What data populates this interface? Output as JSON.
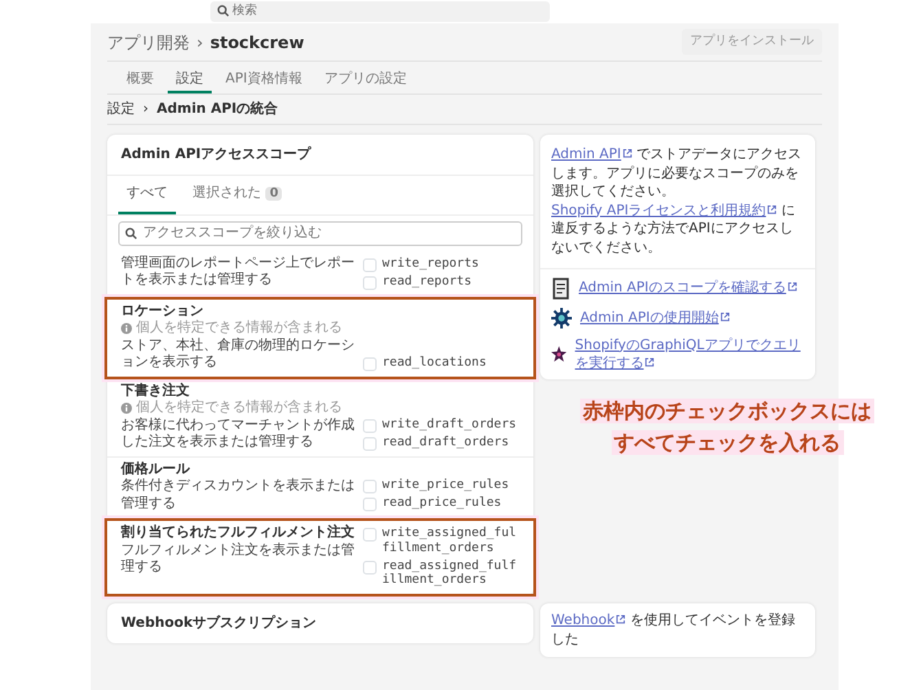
{
  "search_bar": {
    "placeholder": "検索"
  },
  "header": {
    "parent": "アプリ開発",
    "separator": "›",
    "app_name": "stockcrew",
    "install_button": "アプリをインストール"
  },
  "tabs": [
    {
      "label": "概要",
      "selected": false
    },
    {
      "label": "設定",
      "selected": true
    },
    {
      "label": "API資格情報",
      "selected": false
    },
    {
      "label": "アプリの設定",
      "selected": false
    }
  ],
  "breadcrumb": {
    "parent": "設定",
    "separator": "›",
    "current": "Admin APIの統合"
  },
  "scopes_card": {
    "title": "Admin APIアクセススコープ",
    "filter_tabs": [
      {
        "label": "すべて",
        "selected": true
      },
      {
        "label": "選択された",
        "selected": false,
        "count": "0"
      }
    ],
    "search": {
      "placeholder": "アクセススコープを絞り込む"
    },
    "groups": [
      {
        "description": "管理画面のレポートページ上でレポートを表示または管理する",
        "highlighted": false,
        "scopes": [
          {
            "name": "write_reports",
            "checked": false
          },
          {
            "name": "read_reports",
            "checked": false
          }
        ]
      },
      {
        "title": "ロケーション",
        "note": "個人を特定できる情報が含まれる",
        "description": "ストア、本社、倉庫の物理的ロケーションを表示する",
        "highlighted": true,
        "scopes": [
          {
            "name": "read_locations",
            "checked": false
          }
        ]
      },
      {
        "title": "下書き注文",
        "note": "個人を特定できる情報が含まれる",
        "description": "お客様に代わってマーチャントが作成した注文を表示または管理する",
        "highlighted": false,
        "scopes": [
          {
            "name": "write_draft_orders",
            "checked": false
          },
          {
            "name": "read_draft_orders",
            "checked": false
          }
        ]
      },
      {
        "title": "価格ルール",
        "description": "条件付きディスカウントを表示または管理する",
        "highlighted": false,
        "scopes": [
          {
            "name": "write_price_rules",
            "checked": false
          },
          {
            "name": "read_price_rules",
            "checked": false
          }
        ]
      },
      {
        "title": "割り当てられたフルフィルメント注文",
        "description": "フルフィルメント注文を表示または管理する",
        "highlighted": true,
        "scopes": [
          {
            "name": "write_assigned_fulfillment_orders",
            "checked": false
          },
          {
            "name": "read_assigned_fulfillment_orders",
            "checked": false
          }
        ]
      }
    ]
  },
  "info_card": {
    "paragraph": [
      {
        "kind": "link",
        "text": "Admin API"
      },
      {
        "kind": "text",
        "text": "でストアデータにアクセスします。アプリに必要なスコープのみを選択してください。"
      },
      {
        "kind": "link",
        "text": "Shopify APIライセンスと利用規約"
      },
      {
        "kind": "text",
        "text": "に違反するような方法でAPIにアクセスしないでください。"
      }
    ],
    "links": [
      {
        "kind": "document",
        "text": "Admin APIのスコープを確認する"
      },
      {
        "kind": "gear",
        "text": "Admin APIの使用開始"
      },
      {
        "kind": "star",
        "text": "ShopifyのGraphiQLアプリでクエリを実行する"
      }
    ]
  },
  "webhook_card": {
    "title": "Webhookサブスクリプション"
  },
  "webhook_info": [
    {
      "kind": "link",
      "text": "Webhook"
    },
    {
      "kind": "text",
      "text": "を使用してイベントを登録した"
    }
  ],
  "annotation": {
    "lines": [
      "赤枠内のチェックボックスには",
      "すべてチェックを入れる"
    ]
  }
}
